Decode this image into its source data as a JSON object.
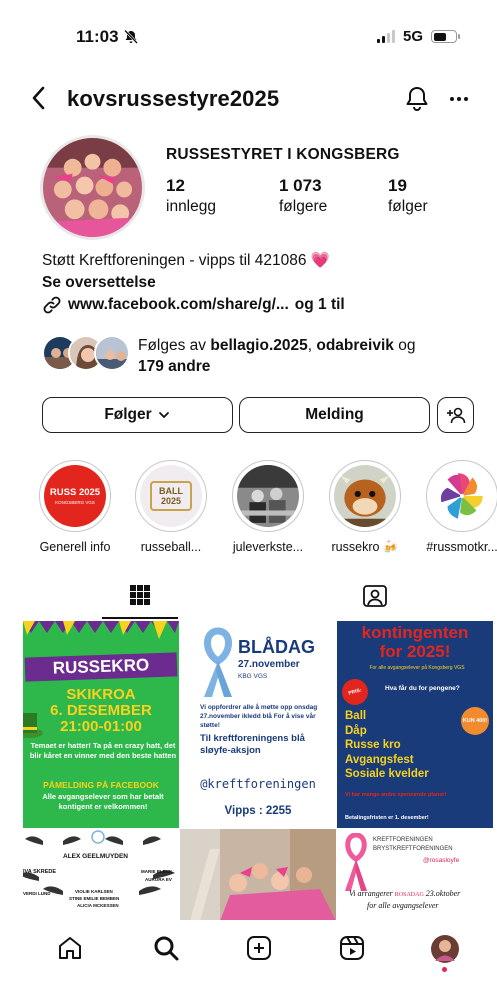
{
  "status_bar": {
    "time": "11:03",
    "network": "5G"
  },
  "header": {
    "username": "kovsrussestyre2025"
  },
  "profile": {
    "full_name": "RUSSESTYRET I KONGSBERG",
    "stats": [
      {
        "value": "12",
        "label": "innlegg"
      },
      {
        "value": "1 073",
        "label": "følgere"
      },
      {
        "value": "19",
        "label": "følger"
      }
    ],
    "bio_line": "Støtt Kreftforeningen - vipps til 421086 💗",
    "translate": "Se oversettelse",
    "link": "www.facebook.com/share/g/...",
    "link_more": "og 1 til",
    "followed_by": {
      "prefix": "Følges av",
      "user1": "bellagio.2025",
      "sep": ",",
      "user2": "odabreivik",
      "and": "og",
      "others": "179 andre"
    }
  },
  "actions": {
    "following_label": "Følger",
    "message_label": "Melding"
  },
  "highlights": [
    {
      "label": "Generell info",
      "badge": "RUSS 2025",
      "badge_sub": "KONGSBERG VGS"
    },
    {
      "label": "russeball...",
      "badge": "BALL 2025"
    },
    {
      "label": "juleverkste..."
    },
    {
      "label": "russekro 🍻"
    },
    {
      "label": "#russmotkr..."
    }
  ],
  "posts": {
    "post1": {
      "title": "RUSSEKRO",
      "place": "SKIKROA",
      "date": "6. DESEMBER",
      "time": "21:00-01:00",
      "text": "Temaet er hatter! Ta på en crazy hatt, det blir kåret en vinner med den beste hatten",
      "cta": "PÅMELDING PÅ FACEBOOK",
      "note": "Alle avgangselever som har betalt kontigent er velkommen!"
    },
    "post2": {
      "title": "BLÅDAG",
      "date": "27.november",
      "school": "KBG VGS",
      "text": "Vi oppfordrer alle å møtte opp onsdag 27.november ikledd blå For å vise vår støtte!",
      "highlight": "Til kreftforeningens blå sløyfe-aksjon",
      "handle": "@kreftforeningen",
      "vipps": "Vipps : 2255"
    },
    "post3": {
      "title1": "kontingenten",
      "title2": "for 2025!",
      "sub": "For alle avgangselever på Kongsberg VGS",
      "question": "Hva får du for pengene?",
      "badge1": "PRIS:",
      "badge2": "KUN 400!",
      "items": [
        "Ball",
        "Dåp",
        "Russe kro",
        "Avgangsfest",
        "Sosiale kvelder"
      ],
      "note": "Vi har mange andre spennende planer!",
      "deadline": "Betalingsfristen er 1. desember!"
    },
    "post4": {
      "names": [
        "ALEX GEELMUYDEN",
        "IVA SKREDE",
        "MARIE BLEKK",
        "AURORA EV",
        "VERDI LUND",
        "VIOLIE KARLSEN",
        "STINE EMILIE BEMBEN",
        "ALICIA MCKESSEN"
      ]
    },
    "post6": {
      "org1": "KREFTFORENINGEN",
      "org2": "BRYSTKREFTFORENINGEN",
      "handle": "@rosasloyfe",
      "text1": "Vi arrangerer",
      "rosadag": "ROSADAG",
      "date": "23.oktober",
      "text2": "for alle avgangselever"
    }
  },
  "colors": {
    "green": "#2eb84b",
    "purple": "#6c2b8e",
    "navy": "#1a3b7a",
    "red": "#e3261d",
    "pink": "#e0245e"
  }
}
